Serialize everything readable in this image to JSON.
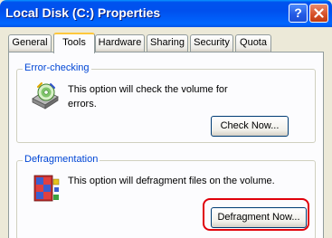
{
  "window": {
    "title": "Local Disk (C:) Properties",
    "help_glyph": "?"
  },
  "tabs": [
    {
      "label": "General"
    },
    {
      "label": "Tools",
      "active": true
    },
    {
      "label": "Hardware"
    },
    {
      "label": "Sharing"
    },
    {
      "label": "Security"
    },
    {
      "label": "Quota"
    }
  ],
  "error_checking": {
    "title": "Error-checking",
    "description_line1": "This option will check the volume for",
    "description_line2": "errors.",
    "button_label": "Check Now...",
    "icon": "disk-check-icon"
  },
  "defragmentation": {
    "title": "Defragmentation",
    "description": "This option will defragment files on the volume.",
    "button_label": "Defragment Now...",
    "icon": "defragment-icon"
  },
  "colors": {
    "titlebar": "#0054e3",
    "group_title": "#0046d5",
    "highlight": "#e0000a",
    "active_tab_accent": "#ffc83c"
  }
}
